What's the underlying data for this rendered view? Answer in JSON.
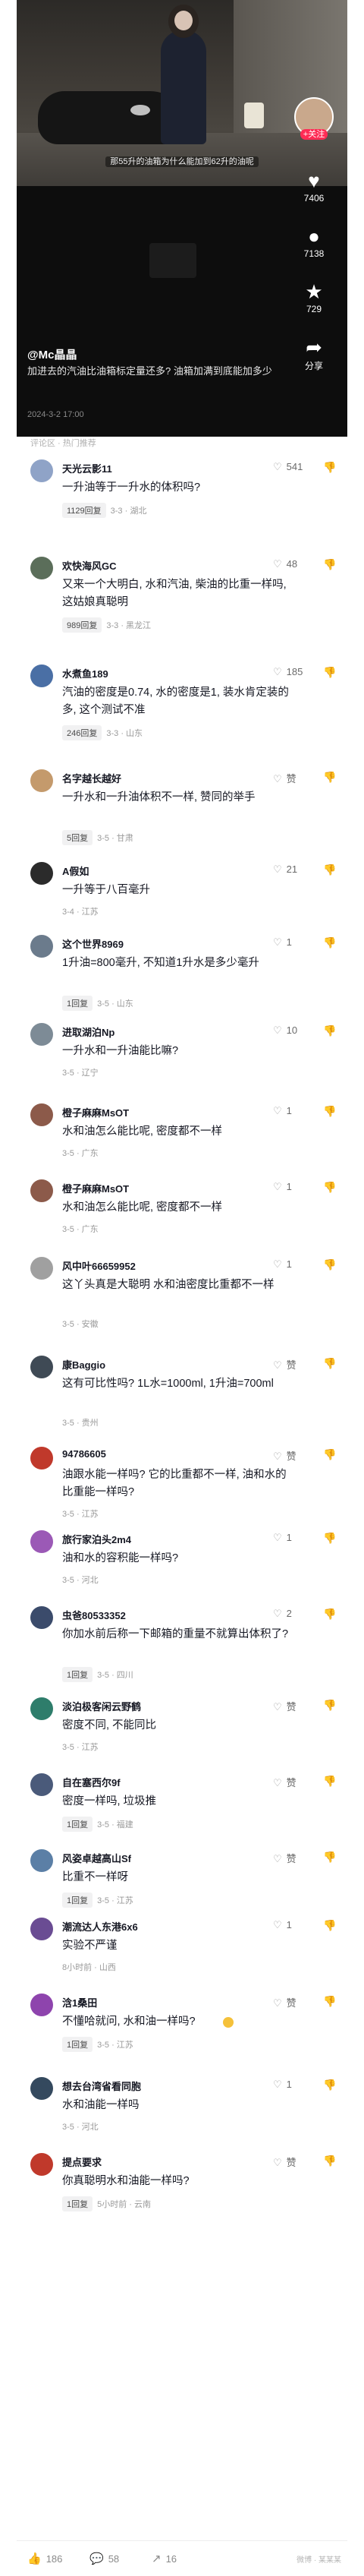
{
  "video": {
    "subtitle": "那55升的油箱为什么能加到62升的油呢",
    "author": "@Mc晶晶",
    "description": "加进去的汽油比油箱标定量还多? 油箱加满到底能加多少",
    "date": "2024-3-2 17:00",
    "follow_label": "+关注",
    "side_actions": [
      {
        "icon": "heart-icon",
        "glyph": "♥",
        "count": "7406"
      },
      {
        "icon": "comment-icon",
        "glyph": "●",
        "count": "7138"
      },
      {
        "icon": "star-icon",
        "glyph": "★",
        "count": "729"
      },
      {
        "icon": "share-icon",
        "glyph": "➦",
        "count": "分享"
      }
    ]
  },
  "comment_header": "评论区 · 热门推荐",
  "comments": [
    {
      "name": "天光云影11",
      "text": "一升油等于一升水的体积吗?",
      "reply": "1129回复",
      "time": "3-3 · 湖北",
      "likes": "541",
      "avatar_color": "#8fa3c7"
    },
    {
      "name": "欢快海风GC",
      "text": "又来一个大明白, 水和汽油, 柴油的比重一样吗, 这姑娘真聪明",
      "reply": "989回复",
      "time": "3-3 · 黑龙江",
      "likes": "48",
      "avatar_color": "#5b6e5a"
    },
    {
      "name": "水煮鱼189",
      "text": "汽油的密度是0.74, 水的密度是1, 装水肯定装的多, 这个测试不准",
      "reply": "246回复",
      "time": "3-3 · 山东",
      "likes": "185",
      "avatar_color": "#4a6fa5"
    },
    {
      "name": "名字越长越好",
      "text": "一升水和一升油体积不一样, 赞同的举手",
      "reply": "5回复",
      "time": "3-5 · 甘肃",
      "likes": "赞",
      "avatar_color": "#c49a6c"
    },
    {
      "name": "A假如",
      "text": "一升等于八百毫升",
      "reply": "",
      "time": "3-4 · 江苏",
      "likes": "21",
      "avatar_color": "#2b2b2b"
    },
    {
      "name": "这个世界8969",
      "text": "1升油=800毫升, 不知道1升水是多少毫升",
      "reply": "1回复",
      "time": "3-5 · 山东",
      "likes": "1",
      "avatar_color": "#6b7b8c"
    },
    {
      "name": "进取湖泊Np",
      "text": "一升水和一升油能比嘛?",
      "reply": "",
      "time": "3-5 · 辽宁",
      "likes": "10",
      "avatar_color": "#7d8b96"
    },
    {
      "name": "橙子麻麻MsOT",
      "text": "水和油怎么能比呢, 密度都不一样",
      "reply": "",
      "time": "3-5 · 广东",
      "likes": "1",
      "avatar_color": "#8c5a4a"
    },
    {
      "name": "橙子麻麻MsOT",
      "text": "水和油怎么能比呢, 密度都不一样",
      "reply": "",
      "time": "3-5 · 广东",
      "likes": "1",
      "avatar_color": "#8c5a4a"
    },
    {
      "name": "风中叶66659952",
      "text": "这丫头真是大聪明 水和油密度比重都不一样",
      "reply": "",
      "time": "3-5 · 安徽",
      "likes": "1",
      "avatar_color": "#a0a0a0"
    },
    {
      "name": "康Baggio",
      "text": "这有可比性吗? 1L水=1000ml, 1升油=700ml",
      "reply": "",
      "time": "3-5 · 贵州",
      "likes": "赞",
      "avatar_color": "#3f4a55"
    },
    {
      "name": "94786605",
      "text": "油跟水能一样吗? 它的比重都不一样, 油和水的比重能一样吗?",
      "reply": "",
      "time": "3-5 · 江苏",
      "likes": "赞",
      "avatar_color": "#c0392b"
    },
    {
      "name": "旅行家泊头2m4",
      "text": "油和水的容积能一样吗?",
      "reply": "",
      "time": "3-5 · 河北",
      "likes": "1",
      "avatar_color": "#9b59b6"
    },
    {
      "name": "虫爸80533352",
      "text": "你加水前后称一下邮箱的重量不就算出体积了?",
      "reply": "1回复",
      "time": "3-5 · 四川",
      "likes": "2",
      "avatar_color": "#3b4b6b"
    },
    {
      "name": "淡泊极客闲云野鹤",
      "text": "密度不同, 不能同比",
      "reply": "",
      "time": "3-5 · 江苏",
      "likes": "赞",
      "avatar_color": "#2e7d6b"
    },
    {
      "name": "自在塞西尔9f",
      "text": "密度一样吗, 垃圾推",
      "reply": "1回复",
      "time": "3-5 · 福建",
      "likes": "赞",
      "avatar_color": "#4a5a7a"
    },
    {
      "name": "风姿卓越高山Sf",
      "text": "比重不一样呀",
      "reply": "1回复",
      "time": "3-5 · 江苏",
      "likes": "赞",
      "avatar_color": "#5b7fa6"
    },
    {
      "name": "潮流达人东港6x6",
      "text": "实验不严谨",
      "reply": "",
      "time": "8小时前 · 山西",
      "likes": "1",
      "avatar_color": "#6a4c93"
    },
    {
      "name": "浛1桑田",
      "text": "不懂哈就问, 水和油一样吗?",
      "reply": "1回复",
      "time": "3-5 · 江苏",
      "likes": "赞",
      "avatar_color": "#8e44ad",
      "emoji": true
    },
    {
      "name": "想去台湾省看同胞",
      "text": "水和油能一样吗",
      "reply": "",
      "time": "3-5 · 河北",
      "likes": "1",
      "avatar_color": "#34495e"
    },
    {
      "name": "提点要求",
      "text": "你真聪明水和油能一样吗?",
      "reply": "1回复",
      "time": "5小时前 · 云南",
      "likes": "赞",
      "avatar_color": "#c0392b"
    }
  ],
  "bottom_bar": [
    {
      "icon": "like-icon",
      "glyph": "👍",
      "count": "186"
    },
    {
      "icon": "comment-icon",
      "glyph": "💬",
      "count": "58"
    },
    {
      "icon": "share-icon",
      "glyph": "↗",
      "count": "16"
    }
  ],
  "watermark": "微博 · 某某某"
}
